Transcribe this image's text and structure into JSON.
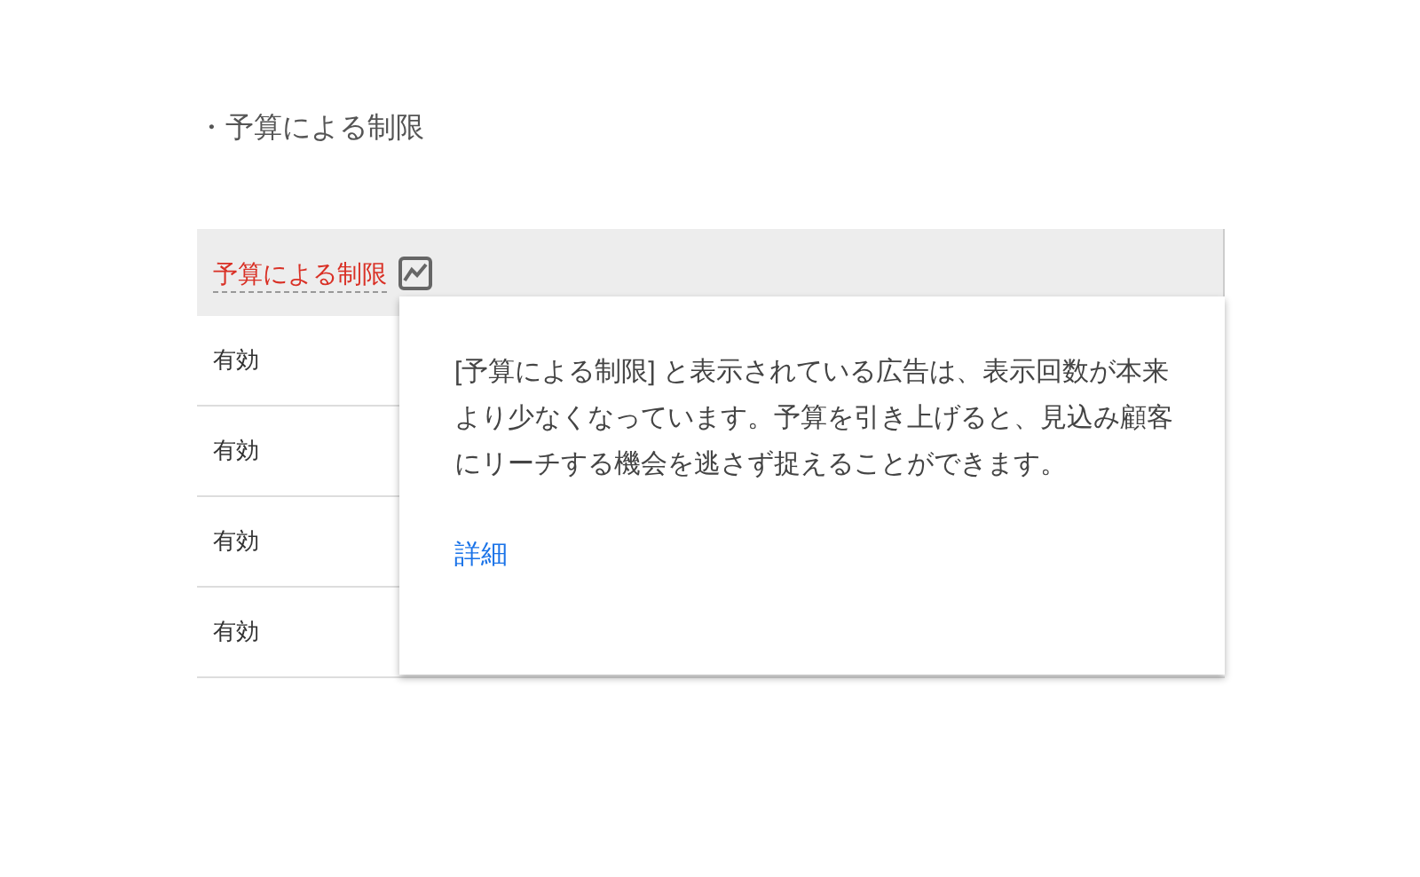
{
  "heading": "・予算による制限",
  "table": {
    "columns": [
      {
        "label": "予算による制限"
      }
    ],
    "rows": [
      {
        "column_1": "有効"
      },
      {
        "column_1": "有効"
      },
      {
        "column_1": "有効"
      },
      {
        "column_1": "有効"
      }
    ]
  },
  "tooltip": {
    "text": "[予算による制限] と表示されている広告は、表示回数が本来より少なくなっています。予算を引き上げると、見込み顧客にリーチする機会を逃さず捉えることができます。",
    "link": "詳細"
  }
}
